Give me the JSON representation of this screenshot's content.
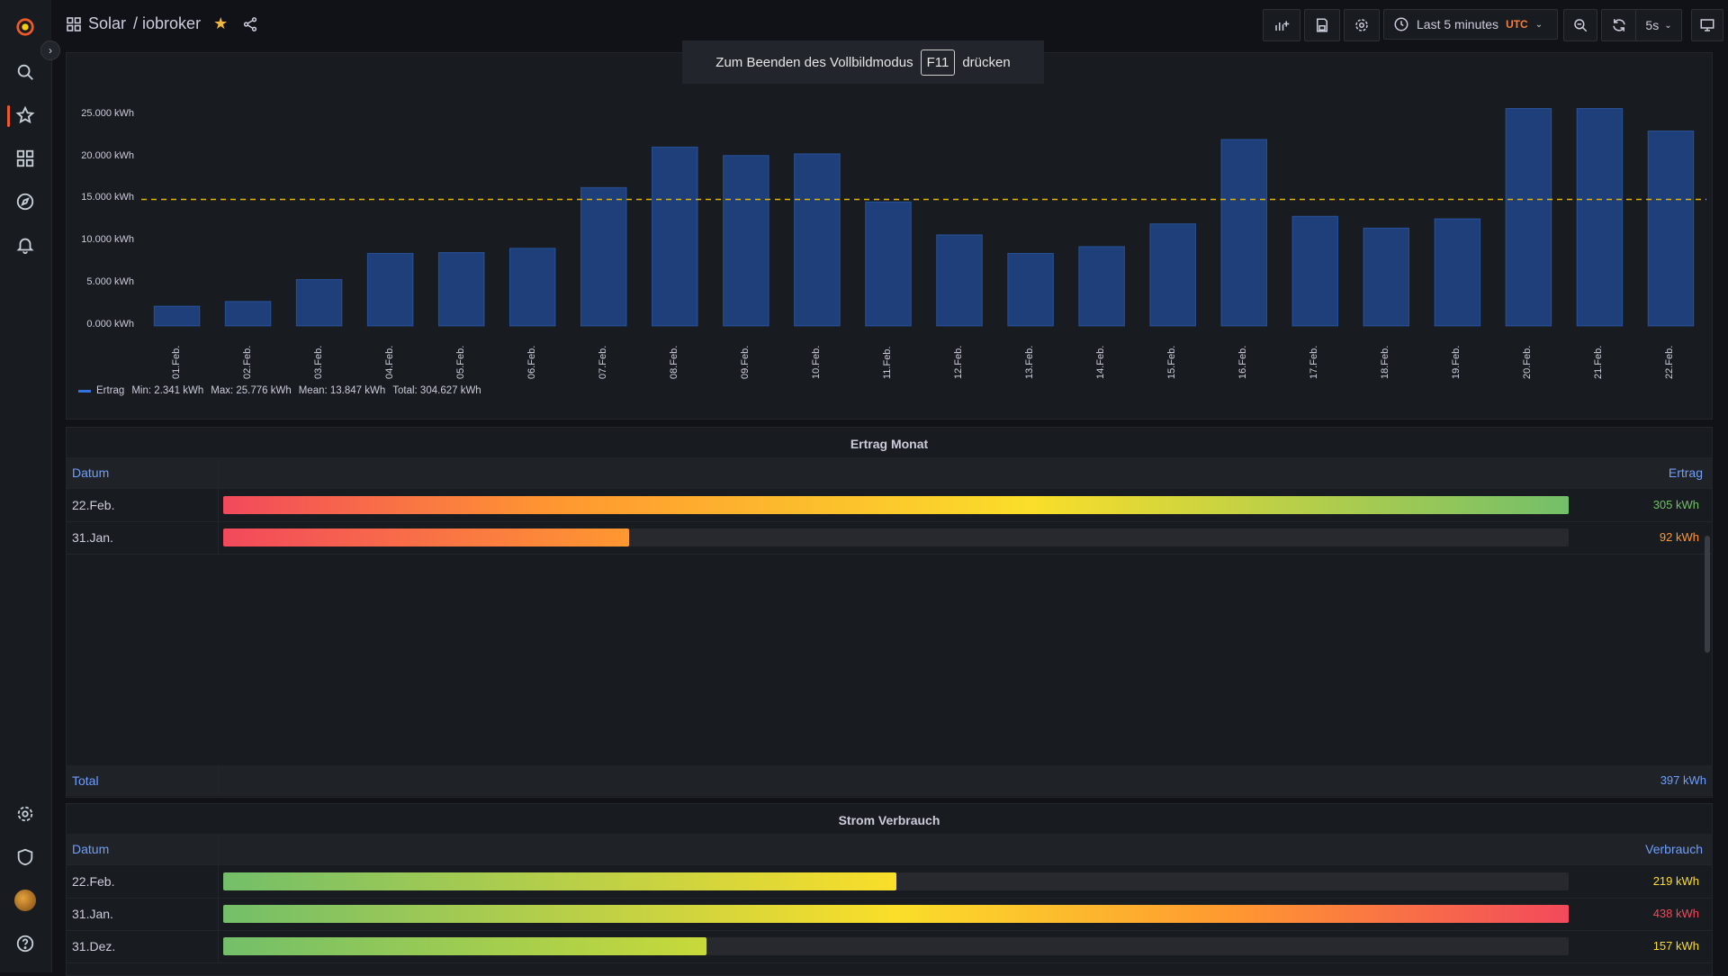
{
  "breadcrumb": {
    "folder": "Solar",
    "dashboard": "/ iobroker"
  },
  "toolbar": {
    "time_range": "Last 5 minutes",
    "timezone": "UTC",
    "refresh_interval": "5s"
  },
  "fullscreen_hint": {
    "before": "Zum Beenden des Vollbildmodus",
    "key": "F11",
    "after": "drücken"
  },
  "chart_data": {
    "type": "bar",
    "categories": [
      "01.Feb.",
      "02.Feb.",
      "03.Feb.",
      "04.Feb.",
      "05.Feb.",
      "06.Feb.",
      "07.Feb.",
      "08.Feb.",
      "09.Feb.",
      "10.Feb.",
      "11.Feb.",
      "12.Feb.",
      "13.Feb.",
      "14.Feb.",
      "15.Feb.",
      "16.Feb.",
      "17.Feb.",
      "18.Feb.",
      "19.Feb.",
      "20.Feb.",
      "21.Feb.",
      "22.Feb."
    ],
    "series": [
      {
        "name": "Ertrag",
        "values": [
          2.341,
          2.9,
          5.5,
          8.6,
          8.7,
          9.2,
          16.4,
          21.2,
          20.2,
          20.4,
          14.7,
          10.8,
          8.6,
          9.4,
          12.1,
          22.1,
          13.0,
          11.6,
          12.7,
          25.776,
          25.776,
          23.1
        ]
      }
    ],
    "yticks": [
      "0.000 kWh",
      "5.000 kWh",
      "10.000 kWh",
      "15.000 kWh",
      "20.000 kWh",
      "25.000 kWh"
    ],
    "ylim": [
      0,
      27
    ],
    "threshold": 15,
    "color": "#1f3f7a",
    "threshold_color": "#e0b400",
    "legend": {
      "name": "Ertrag",
      "min": "Min: 2.341 kWh",
      "max": "Max: 25.776 kWh",
      "mean": "Mean: 13.847 kWh",
      "total": "Total: 304.627 kWh"
    }
  },
  "ertrag_panel": {
    "title": "Ertrag Monat",
    "col_date": "Datum",
    "col_value": "Ertrag",
    "rows": [
      {
        "date": "22.Feb.",
        "value": "305 kWh",
        "fraction": 1.0,
        "value_color": "#73bf69",
        "gradient": "linear-gradient(90deg,#f2495c,#ff9830 25%,#fade2a 60%,#73bf69)"
      },
      {
        "date": "31.Jan.",
        "value": "92 kWh",
        "fraction": 0.302,
        "value_color": "#ff9830",
        "gradient": "linear-gradient(90deg,#f2495c,#ff9830)"
      }
    ],
    "total_label": "Total",
    "total_value": "397 kWh"
  },
  "verbrauch_panel": {
    "title": "Strom Verbrauch",
    "col_date": "Datum",
    "col_value": "Verbrauch",
    "rows": [
      {
        "date": "22.Feb.",
        "value": "219 kWh",
        "fraction": 0.5,
        "value_color": "#fade2a",
        "gradient": "linear-gradient(90deg,#73bf69,#fade2a)"
      },
      {
        "date": "31.Jan.",
        "value": "438 kWh",
        "fraction": 1.0,
        "value_color": "#f2495c",
        "gradient": "linear-gradient(90deg,#73bf69,#fade2a 50%,#ff9830 75%,#f2495c)"
      },
      {
        "date": "31.Dez.",
        "value": "157 kWh",
        "fraction": 0.359,
        "value_color": "#fade2a",
        "gradient": "linear-gradient(90deg,#73bf69,#c8d93a)"
      }
    ]
  }
}
